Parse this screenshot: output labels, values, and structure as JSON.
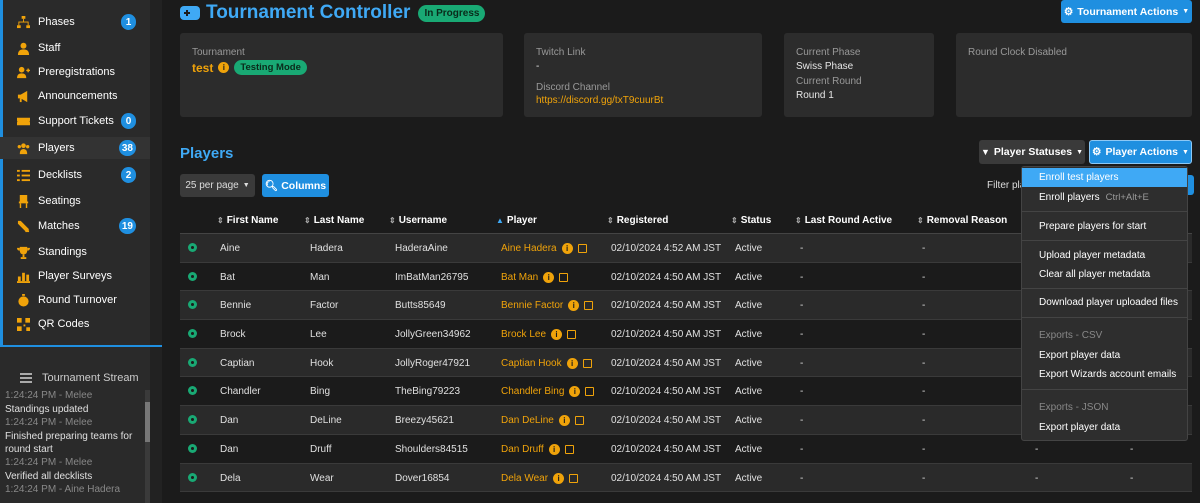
{
  "sidebar": {
    "items": [
      {
        "label": "Phases",
        "badge": "1",
        "icon": "sitemap-icon"
      },
      {
        "label": "Staff",
        "icon": "user-tie-icon"
      },
      {
        "label": "Preregistrations",
        "icon": "user-plus-icon"
      },
      {
        "label": "Announcements",
        "icon": "megaphone-icon"
      },
      {
        "label": "Support Tickets",
        "badge": "0",
        "icon": "ticket-icon"
      },
      {
        "label": "Players",
        "badge": "38",
        "icon": "users-icon",
        "active": true
      },
      {
        "label": "Decklists",
        "badge": "2",
        "icon": "list-icon"
      },
      {
        "label": "Seatings",
        "icon": "chair-icon"
      },
      {
        "label": "Matches",
        "badge": "19",
        "icon": "swords-icon"
      },
      {
        "label": "Standings",
        "icon": "trophy-icon"
      },
      {
        "label": "Player Surveys",
        "icon": "chart-icon"
      },
      {
        "label": "Round Turnover",
        "icon": "stopwatch-icon"
      },
      {
        "label": "QR Codes",
        "icon": "qrcode-icon"
      }
    ],
    "stream_title": "Tournament Stream",
    "stream": [
      {
        "time": "1:24:24 PM - Melee",
        "msg": "Standings updated"
      },
      {
        "time": "1:24:24 PM - Melee",
        "msg": "Finished preparing teams for round start"
      },
      {
        "time": "1:24:24 PM - Melee",
        "msg": "Verified all decklists"
      },
      {
        "time": "1:24:24 PM - Aine Hadera",
        "msg": ""
      }
    ]
  },
  "header": {
    "title": "Tournament Controller",
    "status": "In Progress",
    "actions_label": "Tournament Actions"
  },
  "cards": {
    "tournament_label": "Tournament",
    "tournament_name": "test",
    "mode": "Testing Mode",
    "twitch_label": "Twitch Link",
    "twitch_value": "-",
    "discord_label": "Discord Channel",
    "discord_value": "https://discord.gg/txT9cuurBt",
    "phase_label": "Current Phase",
    "phase_value": "Swiss Phase",
    "round_label": "Current Round",
    "round_value": "Round 1",
    "clock": "Round Clock Disabled"
  },
  "players": {
    "title": "Players",
    "per_page": "25 per page",
    "columns_label": "Columns",
    "statuses_label": "Player Statuses",
    "actions_label": "Player Actions",
    "filter_label": "Filter pla",
    "headers": [
      "First Name",
      "Last Name",
      "Username",
      "Player",
      "Registered",
      "Status",
      "Last Round Active",
      "Removal Reason"
    ],
    "rows": [
      {
        "first": "Aine",
        "last": "Hadera",
        "user": "HaderaAine",
        "player": "Aine Hadera",
        "reg": "02/10/2024 4:52 AM JST",
        "status": "Active",
        "lra": "-",
        "removal": "-"
      },
      {
        "first": "Bat",
        "last": "Man",
        "user": "ImBatMan26795",
        "player": "Bat Man",
        "reg": "02/10/2024 4:50 AM JST",
        "status": "Active",
        "lra": "-",
        "removal": "-"
      },
      {
        "first": "Bennie",
        "last": "Factor",
        "user": "Butts85649",
        "player": "Bennie Factor",
        "reg": "02/10/2024 4:50 AM JST",
        "status": "Active",
        "lra": "-",
        "removal": "-"
      },
      {
        "first": "Brock",
        "last": "Lee",
        "user": "JollyGreen34962",
        "player": "Brock Lee",
        "reg": "02/10/2024 4:50 AM JST",
        "status": "Active",
        "lra": "-",
        "removal": "-"
      },
      {
        "first": "Captian",
        "last": "Hook",
        "user": "JollyRoger47921",
        "player": "Captian Hook",
        "reg": "02/10/2024 4:50 AM JST",
        "status": "Active",
        "lra": "-",
        "removal": "-"
      },
      {
        "first": "Chandler",
        "last": "Bing",
        "user": "TheBing79223",
        "player": "Chandler Bing",
        "reg": "02/10/2024 4:50 AM JST",
        "status": "Active",
        "lra": "-",
        "removal": "-"
      },
      {
        "first": "Dan",
        "last": "DeLine",
        "user": "Breezy45621",
        "player": "Dan DeLine",
        "reg": "02/10/2024 4:50 AM JST",
        "status": "Active",
        "lra": "-",
        "removal": "-"
      },
      {
        "first": "Dan",
        "last": "Druff",
        "user": "Shoulders84515",
        "player": "Dan Druff",
        "reg": "02/10/2024 4:50 AM JST",
        "status": "Active",
        "lra": "-",
        "removal": "-",
        "extra1": "-",
        "extra2": "-"
      },
      {
        "first": "Dela",
        "last": "Wear",
        "user": "Dover16854",
        "player": "Dela Wear",
        "reg": "02/10/2024 4:50 AM JST",
        "status": "Active",
        "lra": "-",
        "removal": "-",
        "extra1": "-",
        "extra2": "-"
      }
    ]
  },
  "dropdown": {
    "items": [
      {
        "label": "Enroll test players",
        "highlight": true
      },
      {
        "label": "Enroll players",
        "shortcut": "Ctrl+Alt+E"
      },
      {
        "label": "Prepare players for start"
      },
      {
        "label": "Upload player metadata"
      },
      {
        "label": "Clear all player metadata"
      },
      {
        "label": "Download player uploaded files"
      },
      {
        "label": "Export player data"
      },
      {
        "label": "Export Wizards account emails"
      },
      {
        "label": "Export player data"
      }
    ],
    "header_csv": "Exports - CSV",
    "header_json": "Exports - JSON"
  },
  "colors": {
    "accent": "#3fa9f5",
    "orange": "#f0a30a",
    "green": "#19a974"
  }
}
